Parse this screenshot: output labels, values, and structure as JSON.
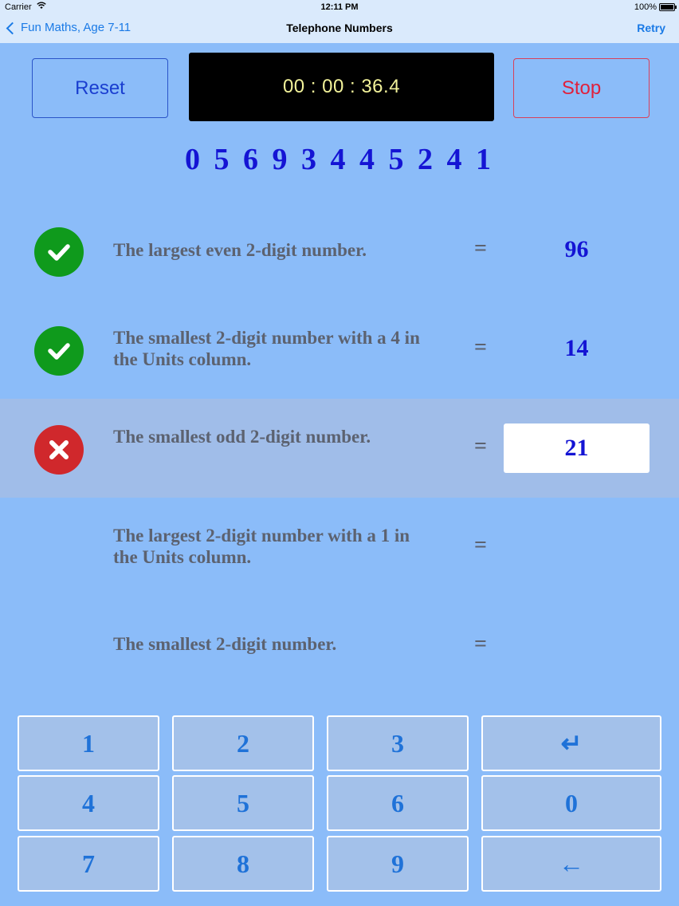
{
  "status_bar": {
    "carrier": "Carrier",
    "time": "12:11 PM",
    "battery": "100%"
  },
  "nav": {
    "back_label": "Fun Maths, Age 7-11",
    "title": "Telephone Numbers",
    "retry_label": "Retry"
  },
  "controls": {
    "reset_label": "Reset",
    "timer": "00 : 00 : 36.4",
    "stop_label": "Stop"
  },
  "phone_number": "0 5 6 9 3 4 4 5 2 4 1",
  "questions": [
    {
      "text": "The largest even 2-digit number.",
      "equals": "=",
      "answer": "96",
      "status": "correct"
    },
    {
      "text": "The smallest 2-digit number with a 4 in the Units column.",
      "equals": "=",
      "answer": "14",
      "status": "correct"
    },
    {
      "text": "The smallest odd 2-digit number.",
      "equals": "=",
      "answer": "21",
      "status": "wrong"
    },
    {
      "text": "The largest 2-digit number with a 1 in the Units column.",
      "equals": "=",
      "answer": "",
      "status": "none"
    },
    {
      "text": "The smallest 2-digit number.",
      "equals": "=",
      "answer": "",
      "status": "none"
    }
  ],
  "keypad": {
    "k1": "1",
    "k2": "2",
    "k3": "3",
    "enter": "↵",
    "k4": "4",
    "k5": "5",
    "k6": "6",
    "k0": "0",
    "k7": "7",
    "k8": "8",
    "k9": "9",
    "backspace": "←"
  },
  "colors": {
    "background": "#8bbcf9",
    "correct": "#0f9a1c",
    "wrong": "#d0282c",
    "answer_text": "#1414d4",
    "key_text": "#1f72d8"
  }
}
